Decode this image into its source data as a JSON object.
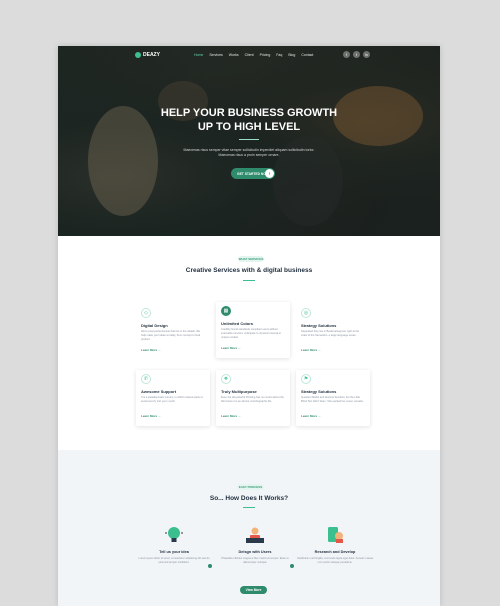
{
  "brand": {
    "name": "DEAZY",
    "accent": "#2e8b6c"
  },
  "nav": {
    "items": [
      "Home",
      "Services",
      "Works",
      "Client",
      "Pricing",
      "Faq",
      "Blog",
      "Contact"
    ],
    "social": [
      "facebook-icon",
      "twitter-icon",
      "linkedin-icon"
    ]
  },
  "hero": {
    "title_line1": "HELP YOUR BUSINESS GROWTH",
    "title_line2": "UP TO HIGH LEVEL",
    "subtitle": "Maecenas risus semper vitae semper sollicitudin imperdiet aliquam sollicitudin tortor. Maecenas risus a proin semper ornare.",
    "cta": "GET STARTED NOW"
  },
  "services": {
    "tag": "WHAT SERVICES",
    "title": "Creative Services with & digital business",
    "cards": [
      {
        "title": "Digital Design",
        "desc": "We're pixel-perfectionists that live in the details. We help make your ideas a reality, from concept to final product.",
        "link": "Learn More"
      },
      {
        "title": "Unlimited Colors",
        "desc": "Credibly brand standards compliant users without extensible services. Anticipate to dynamic internal or unique models.",
        "link": "Learn More"
      },
      {
        "title": "Strategy Solutions",
        "desc": "Separated they live in Bookmarksgrove right at the coast of the Semantics, a large language ocean.",
        "link": "Learn More"
      },
      {
        "title": "Awesome Support",
        "desc": "It is a paradisematic country, in which roasted parts of sentences fly into your mouth.",
        "link": "Learn More"
      },
      {
        "title": "Truly Multipurpose",
        "desc": "Even the all-powerful Pointing has no control about the blind texts it is an almost unorthographic life.",
        "link": "Learn More"
      },
      {
        "title": "Strategy Solutions",
        "desc": "Question Marks and devious Semikoli, but the Little Blind Text didn't listen. She packed her seven versalia.",
        "link": "Learn More"
      }
    ]
  },
  "how": {
    "tag": "EASY PROCESS",
    "title": "So... How Does It Works?",
    "steps": [
      {
        "title": "Tell us your idea",
        "desc": "Lorem ipsum dolor sit amet, consectetur adipiscing elit sed do eiusmod tempor incididunt."
      },
      {
        "title": "Deisgn with Users",
        "desc": "Phasellus ultricies magna a liber maximus tempor. Etiam a ullamcorper volutpat."
      },
      {
        "title": "Research and Develop",
        "desc": "Vestibulum vel fringilla, commodo ligula eget dolor. Aenean massa cum sociis natoque penatibus."
      }
    ],
    "cta": "View More"
  }
}
